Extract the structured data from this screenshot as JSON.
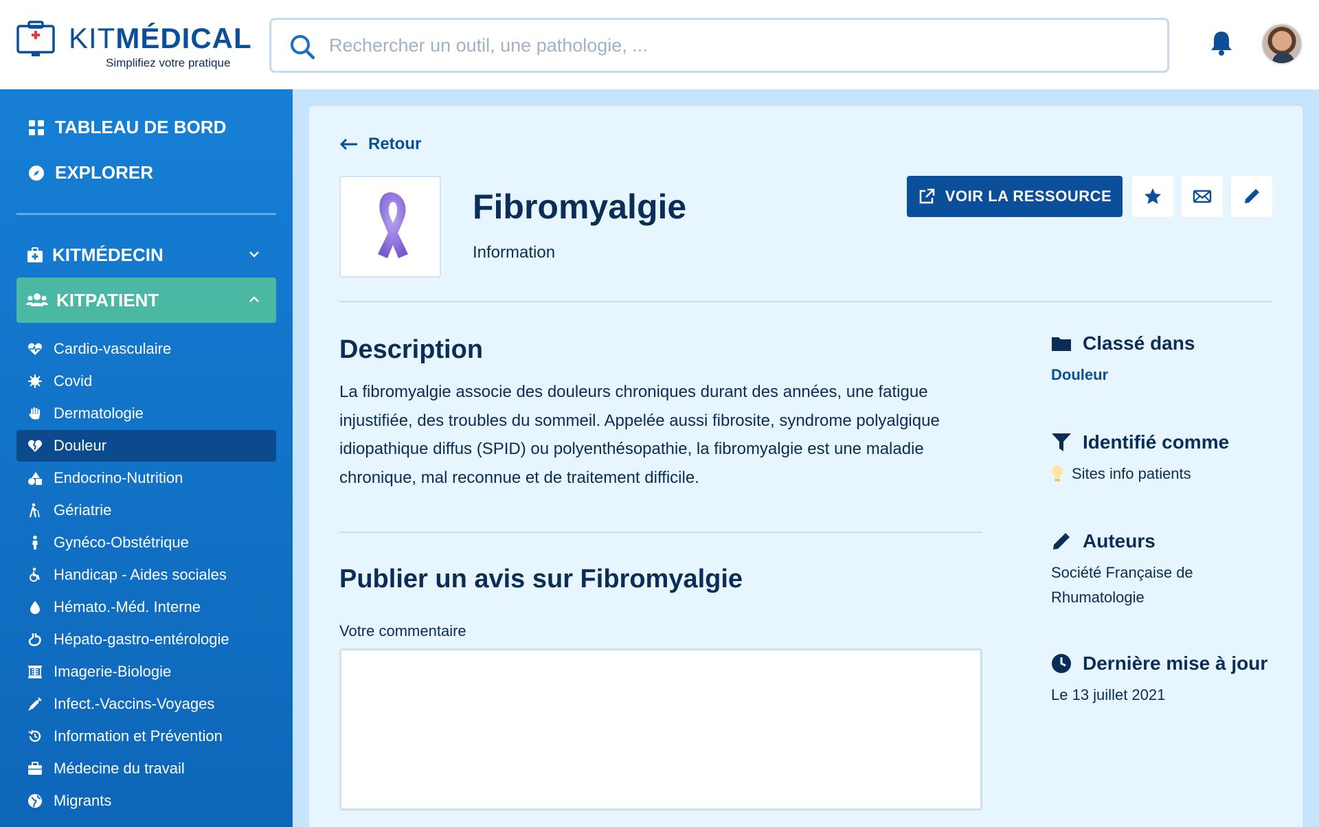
{
  "brand": {
    "name_thin": "KIT",
    "name_bold": "MÉDICAL",
    "tagline": "Simplifiez votre pratique"
  },
  "search": {
    "placeholder": "Rechercher un outil, une pathologie, ..."
  },
  "sidebar": {
    "top": [
      {
        "label": "TABLEAU DE BORD",
        "icon": "grid-icon"
      },
      {
        "label": "EXPLORER",
        "icon": "compass-icon"
      }
    ],
    "sections": [
      {
        "label": "KITMÉDECIN",
        "icon": "medkit-icon",
        "expanded": false
      },
      {
        "label": "KITPATIENT",
        "icon": "users-icon",
        "expanded": true
      }
    ],
    "items": [
      {
        "label": "Cardio-vasculaire",
        "icon": "heart-pulse-icon"
      },
      {
        "label": "Covid",
        "icon": "virus-icon"
      },
      {
        "label": "Dermatologie",
        "icon": "hand-icon"
      },
      {
        "label": "Douleur",
        "icon": "broken-heart-icon",
        "selected": true
      },
      {
        "label": "Endocrino-Nutrition",
        "icon": "shapes-icon"
      },
      {
        "label": "Gériatrie",
        "icon": "walking-cane-icon"
      },
      {
        "label": "Gynéco-Obstétrique",
        "icon": "person-icon"
      },
      {
        "label": "Handicap - Aides sociales",
        "icon": "wheelchair-icon"
      },
      {
        "label": "Hémato.-Méd. Interne",
        "icon": "drop-icon"
      },
      {
        "label": "Hépato-gastro-entérologie",
        "icon": "stomach-icon"
      },
      {
        "label": "Imagerie-Biologie",
        "icon": "xray-icon"
      },
      {
        "label": "Infect.-Vaccins-Voyages",
        "icon": "syringe-icon"
      },
      {
        "label": "Information et Prévention",
        "icon": "history-icon"
      },
      {
        "label": "Médecine du travail",
        "icon": "briefcase-icon"
      },
      {
        "label": "Migrants",
        "icon": "globe-icon"
      }
    ]
  },
  "content": {
    "back_label": "Retour",
    "title": "Fibromyalgie",
    "type": "Information",
    "primary_button": "VOIR LA RESSOURCE",
    "description_heading": "Description",
    "description": "La fibromyalgie associe des douleurs chroniques durant des années, une fatigue injustifiée, des troubles du sommeil. Appelée aussi fibrosite, syndrome polyalgique idiopathique diffus (SPID) ou polyenthésopathie, la fibromyalgie est une maladie chronique, mal reconnue et de traitement difficile.",
    "review_heading": "Publier un avis sur Fibromyalgie",
    "comment_label": "Votre commentaire"
  },
  "meta": {
    "classified_heading": "Classé dans",
    "classified_value": "Douleur",
    "identified_heading": "Identifié comme",
    "identified_value": "Sites info patients",
    "authors_heading": "Auteurs",
    "authors_line1": "Société Française de",
    "authors_line2": "Rhumatologie",
    "updated_heading": "Dernière mise à jour",
    "updated_value": "Le 13 juillet 2021"
  },
  "colors": {
    "primary": "#0b4f9a",
    "sidebar": "#167fd6",
    "active_section": "#4bb8a4",
    "selected_item": "#0b4a8c",
    "panel": "#e6f5fe",
    "ribbon": "#8b6fd8"
  }
}
